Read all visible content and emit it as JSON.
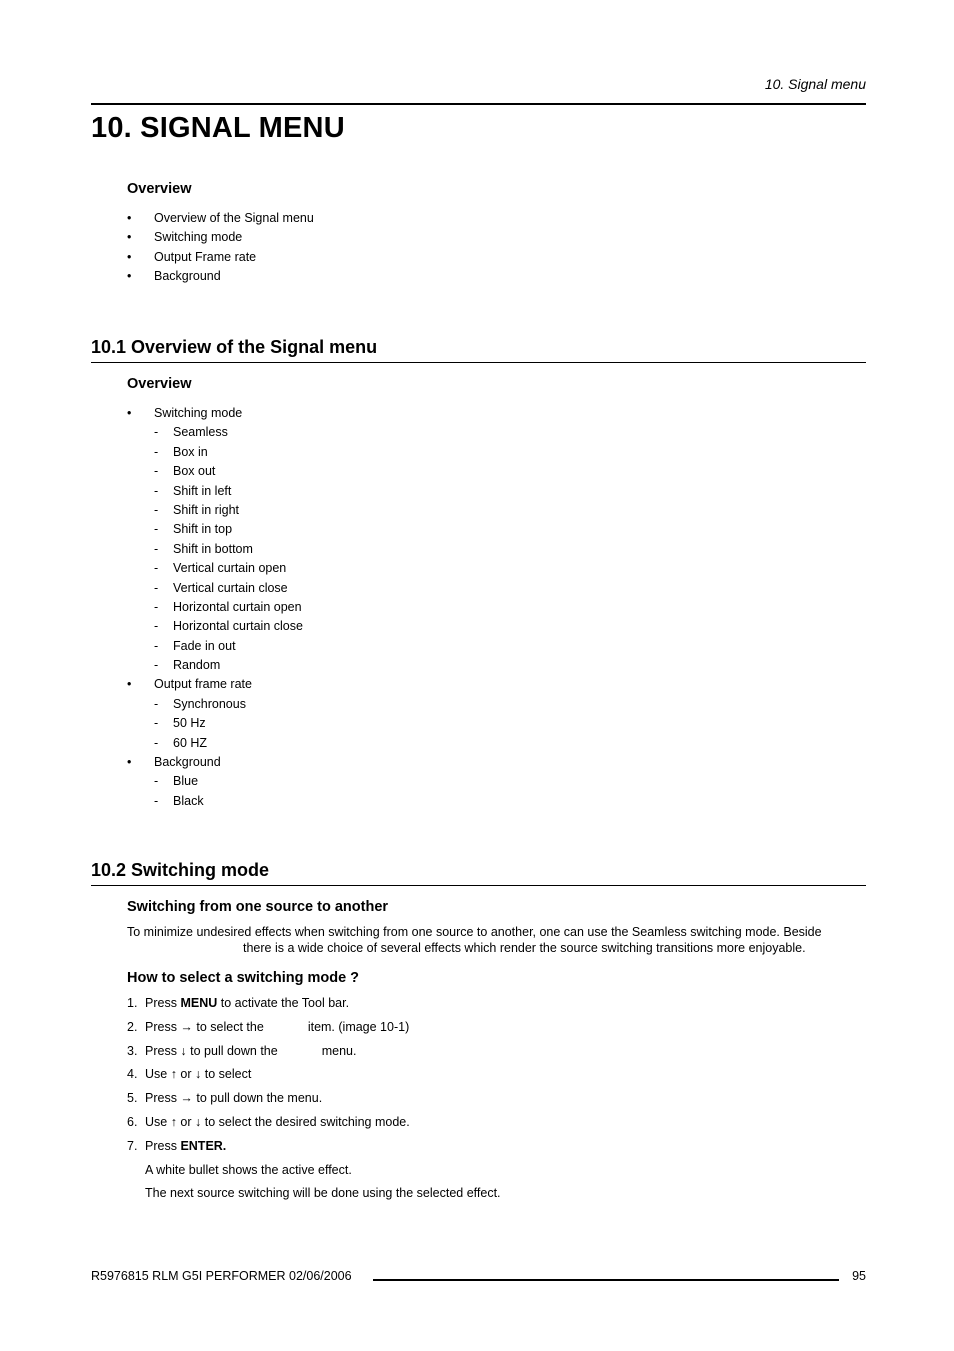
{
  "running_header": "10.  Signal menu",
  "chapter_title": "10. SIGNAL MENU",
  "chapter_overview": {
    "heading": "Overview",
    "items": [
      "Overview of the Signal menu",
      "Switching mode",
      "Output Frame rate",
      "Background"
    ]
  },
  "section_10_1": {
    "heading": "10.1  Overview of the Signal menu",
    "subheading": "Overview",
    "tree": [
      {
        "label": "Switching mode",
        "children": [
          "Seamless",
          "Box in",
          "Box out",
          "Shift in left",
          "Shift in right",
          "Shift in top",
          "Shift in bottom",
          "Vertical curtain open",
          "Vertical curtain close",
          "Horizontal curtain open",
          "Horizontal curtain close",
          "Fade in out",
          "Random"
        ]
      },
      {
        "label": "Output frame rate",
        "children": [
          "Synchronous",
          "50 Hz",
          "60 HZ"
        ]
      },
      {
        "label": "Background",
        "children": [
          "Blue",
          "Black"
        ]
      }
    ]
  },
  "section_10_2": {
    "heading": "10.2  Switching mode",
    "sub1": "Switching from one source to another",
    "para_line1": "To minimize undesired effects when switching from one source to another, one can use the Seamless switching mode.  Beside",
    "para_line2": "there is a wide choice of several effects which render the source switching transitions more enjoyable.",
    "sub2": "How to select a switching mode ?",
    "steps": [
      {
        "num": "1.",
        "pre": "Press ",
        "bold": "MENU",
        "post": " to activate the Tool bar."
      },
      {
        "num": "2.",
        "pre": "Press → to select the",
        "post": "item.  (image 10-1)"
      },
      {
        "num": "3.",
        "pre": "Press ↓ to pull down the",
        "post": "menu."
      },
      {
        "num": "4.",
        "pre": "Use ↑ or ↓ to select"
      },
      {
        "num": "5.",
        "pre": "Press → to pull down the menu."
      },
      {
        "num": "6.",
        "pre": "Use ↑ or ↓ to select the desired switching mode."
      },
      {
        "num": "7.",
        "pre": "Press ",
        "bold": "ENTER."
      }
    ],
    "notes": [
      "A white bullet shows the active effect.",
      "The next source switching will be done using the selected effect."
    ]
  },
  "footer": {
    "doc_info": "R5976815  RLM G5I PERFORMER  02/06/2006",
    "page_number": "95"
  },
  "bullet_glyph": "•",
  "dash_glyph": "-"
}
